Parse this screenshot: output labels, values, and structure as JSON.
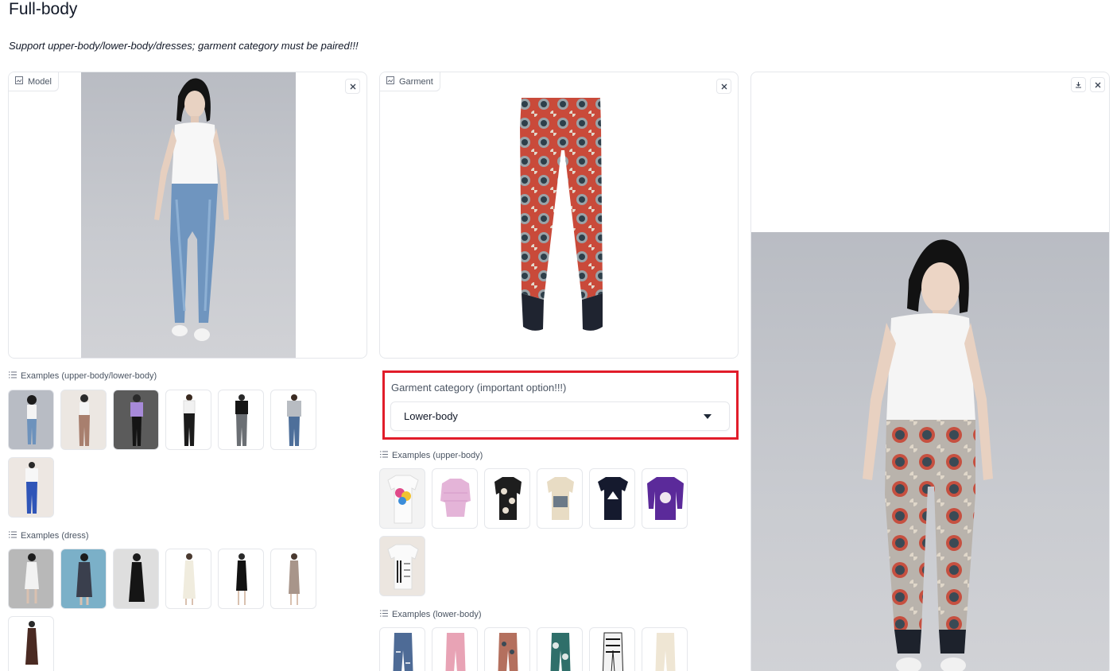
{
  "page": {
    "title": "Full-body",
    "subtitle": "Support upper-body/lower-body/dresses; garment category must be paired!!!"
  },
  "model_panel": {
    "label": "Model",
    "icon": "image-icon",
    "close_icon": "close-icon"
  },
  "garment_panel": {
    "label": "Garment",
    "icon": "image-icon",
    "close_icon": "close-icon"
  },
  "result_panel": {
    "download_icon": "download-icon",
    "close_icon": "close-icon"
  },
  "garment_category": {
    "label": "Garment category (important option!!!)",
    "selected": "Lower-body",
    "highlight_color": "#e11d2a"
  },
  "examples": {
    "model_upper_lower": {
      "label": "Examples (upper-body/lower-body)",
      "items": [
        "model-white-tank-jeans",
        "model-floral-pants",
        "model-purple-tee",
        "model-white-top-black-pants",
        "model-black-tee-grey-jeans",
        "model-grey-sweater-jeans",
        "model-white-tee-blue-pants"
      ]
    },
    "model_dress": {
      "label": "Examples (dress)",
      "items": [
        "dress-white-short",
        "dress-sequin-blue-bg",
        "dress-black-slip",
        "dress-white-long",
        "dress-black-fitted",
        "dress-taupe-midi",
        "dress-brown-ruffle"
      ]
    },
    "garment_upper": {
      "label": "Examples (upper-body)",
      "items": [
        "tee-floral-print",
        "blouse-pink-ruffle",
        "blouse-black-floral",
        "shirt-printed",
        "tee-navy-mountain",
        "sweatshirt-purple-anime",
        "tee-armani-exchange"
      ]
    },
    "garment_lower": {
      "label": "Examples (lower-body)",
      "items": [
        "jeans-distressed",
        "pants-pink",
        "pants-paisley",
        "pants-teal-print",
        "pants-black-white-check",
        "pants-cream"
      ]
    }
  },
  "colors": {
    "accent": "#e11d2a",
    "border": "#e5e7eb",
    "text": "#111827",
    "muted": "#4b5563"
  }
}
